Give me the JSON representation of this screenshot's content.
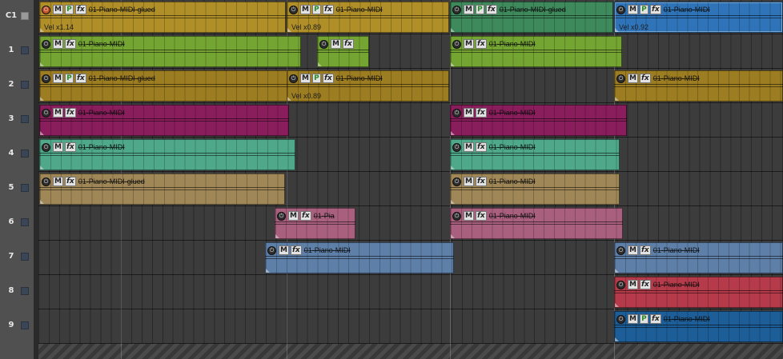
{
  "tracks": [
    {
      "label": "C1"
    },
    {
      "label": "1"
    },
    {
      "label": "2"
    },
    {
      "label": "3"
    },
    {
      "label": "4"
    },
    {
      "label": "5"
    },
    {
      "label": "6"
    },
    {
      "label": "7"
    },
    {
      "label": "8"
    },
    {
      "label": "9"
    }
  ],
  "region_buttons": {
    "mute": "M",
    "play": "P",
    "fx": "fx",
    "power": "⏻"
  },
  "regions": [
    {
      "track": "C1",
      "name": "01-Piano-MIDI-glued",
      "color": "#b08f28",
      "buttons": "MPfx",
      "velocity": "Vel x1.14",
      "power_active": true
    },
    {
      "track": "C1",
      "name": "01-Piano-MIDI",
      "color": "#b08f28",
      "buttons": "MPfx",
      "velocity": "Vel x0.89"
    },
    {
      "track": "C1",
      "name": "01-Piano-MIDI-glued",
      "color": "#3f8a5c",
      "buttons": "MPfx",
      "velocity": ""
    },
    {
      "track": "C1",
      "name": "01-Piano-MIDI",
      "color": "#2f74b8",
      "buttons": "MPfx",
      "velocity": "Vel x0.92"
    },
    {
      "track": "1",
      "name": "01-Piano-MIDI",
      "color": "#74a532",
      "buttons": "Mfx",
      "velocity": ""
    },
    {
      "track": "1",
      "name": "",
      "color": "#74a532",
      "buttons": "Mfx",
      "velocity": ""
    },
    {
      "track": "1",
      "name": "01-Piano-MIDI",
      "color": "#74a532",
      "buttons": "Mfx",
      "velocity": ""
    },
    {
      "track": "2",
      "name": "01-Piano-MIDI-glued",
      "color": "#9d7d21",
      "buttons": "MPfx",
      "velocity": ""
    },
    {
      "track": "2",
      "name": "01-Piano-MIDI",
      "color": "#9d7d21",
      "buttons": "MPfx",
      "velocity": "Vel x0.89"
    },
    {
      "track": "2",
      "name": "01-Piano-MIDI",
      "color": "#9d7d21",
      "buttons": "Mfx",
      "velocity": ""
    },
    {
      "track": "3",
      "name": "01-Piano-MIDI",
      "color": "#8a1e5c",
      "buttons": "Mfx",
      "velocity": ""
    },
    {
      "track": "3",
      "name": "01-Piano-MIDI",
      "color": "#8a1e5c",
      "buttons": "Mfx",
      "velocity": ""
    },
    {
      "track": "4",
      "name": "01-Piano-MIDI",
      "color": "#4fa88a",
      "buttons": "Mfx",
      "velocity": ""
    },
    {
      "track": "4",
      "name": "01-Piano-MIDI",
      "color": "#4fa88a",
      "buttons": "Mfx",
      "velocity": ""
    },
    {
      "track": "5",
      "name": "01-Piano-MIDI-glued",
      "color": "#9f8757",
      "buttons": "Mfx",
      "velocity": ""
    },
    {
      "track": "5",
      "name": "01-Piano-MIDI",
      "color": "#9f8757",
      "buttons": "Mfx",
      "velocity": ""
    },
    {
      "track": "6",
      "name": "01-Pia",
      "color": "#a8607e",
      "buttons": "Mfx",
      "velocity": ""
    },
    {
      "track": "6",
      "name": "01-Piano-MIDI",
      "color": "#a8607e",
      "buttons": "Mfx",
      "velocity": ""
    },
    {
      "track": "7",
      "name": "01-Piano-MIDI",
      "color": "#5e7fa8",
      "buttons": "Mfx",
      "velocity": ""
    },
    {
      "track": "7",
      "name": "01-Piano-MIDI",
      "color": "#5e7fa8",
      "buttons": "Mfx",
      "velocity": ""
    },
    {
      "track": "8",
      "name": "01-Piano-MIDI",
      "color": "#b53b4a",
      "buttons": "Mfx",
      "velocity": ""
    },
    {
      "track": "9",
      "name": "01-Piano-MIDI",
      "color": "#1d5d98",
      "buttons": "MPfx",
      "velocity": ""
    }
  ]
}
